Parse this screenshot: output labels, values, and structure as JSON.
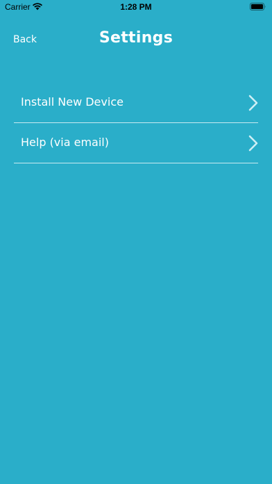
{
  "status_bar": {
    "carrier": "Carrier",
    "time": "1:28 PM"
  },
  "nav": {
    "back_label": "Back",
    "title": "Settings"
  },
  "settings": {
    "items": [
      {
        "label": "Install New Device",
        "icon": "chevron-right-icon"
      },
      {
        "label": "Help (via email)",
        "icon": "chevron-right-icon"
      }
    ]
  },
  "colors": {
    "background": "#2AAEC9",
    "text": "#FFFFFF",
    "status_text": "#000000"
  }
}
